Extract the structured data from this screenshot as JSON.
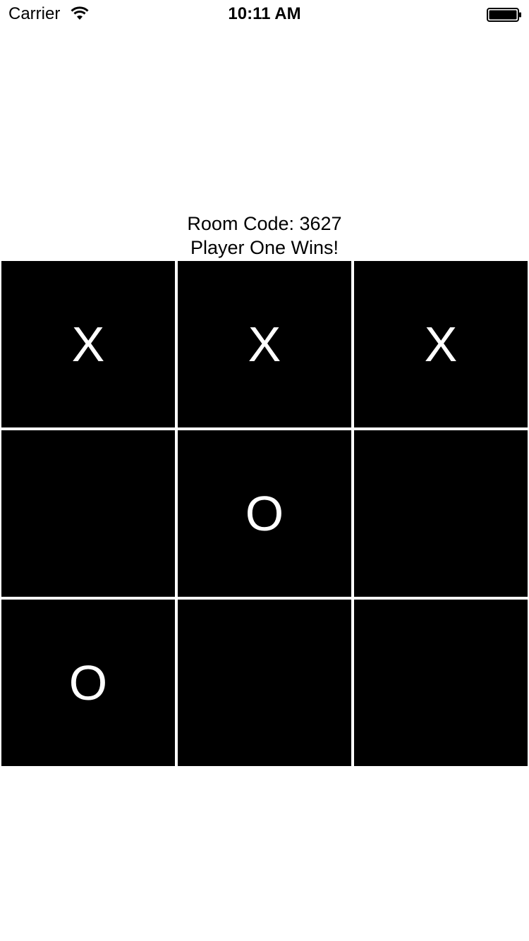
{
  "status_bar": {
    "carrier": "Carrier",
    "time": "10:11 AM",
    "icons": [
      "wifi-icon",
      "battery-icon"
    ]
  },
  "game": {
    "room_code": "Room Code: 3627",
    "status": "Player One Wins!",
    "board": [
      [
        "X",
        "X",
        "X"
      ],
      [
        "",
        "O",
        ""
      ],
      [
        "O",
        "",
        ""
      ]
    ]
  },
  "colors": {
    "cell_background": "#000000",
    "mark_color": "#ffffff",
    "grid_line": "#ffffff"
  }
}
